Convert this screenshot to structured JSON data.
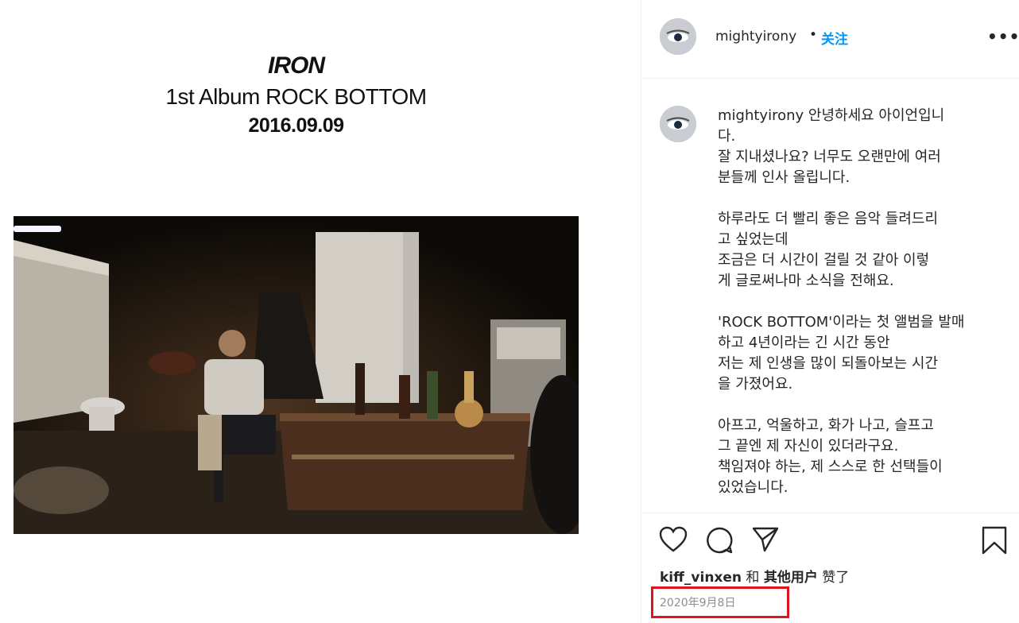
{
  "cover": {
    "artist": "IRON",
    "album": "1st Album ROCK BOTTOM",
    "date": "2016.09.09"
  },
  "header": {
    "username": "mightyirony",
    "separator": "•",
    "follow_label": "关注",
    "more_icon": "more-horizontal-icon"
  },
  "caption": {
    "username": "mightyirony",
    "text": " 안녕하세요 아이언입니\n다.\n잘 지내셨나요? 너무도 오랜만에 여러\n분들께 인사 올립니다.\n\n하루라도 더 빨리 좋은 음악 들려드리\n고 싶었는데\n조금은 더 시간이 걸릴 것 같아 이렇\n게 글로써나마 소식을 전해요.\n\n'ROCK BOTTOM'이라는 첫 앨범을 발매\n하고 4년이라는 긴 시간 동안\n저는 제 인생을 많이 되돌아보는 시간\n을 가졌어요.\n\n아프고, 억울하고, 화가 나고, 슬프고\n그 끝엔 제 자신이 있더라구요.\n책임져야 하는, 제 스스로 한 선택들이\n있었습니다."
  },
  "actions": {
    "like_icon": "heart-icon",
    "comment_icon": "comment-icon",
    "share_icon": "paper-plane-icon",
    "save_icon": "bookmark-icon"
  },
  "likes": {
    "user": "kiff_vinxen",
    "conj": " 和 ",
    "others": "其他用户",
    "suffix": " 赞了"
  },
  "post_date": "2020年9月8日",
  "colors": {
    "follow": "#0095f6",
    "highlight_box": "#e0141e",
    "text": "#262626",
    "muted": "#8e8e8e"
  }
}
